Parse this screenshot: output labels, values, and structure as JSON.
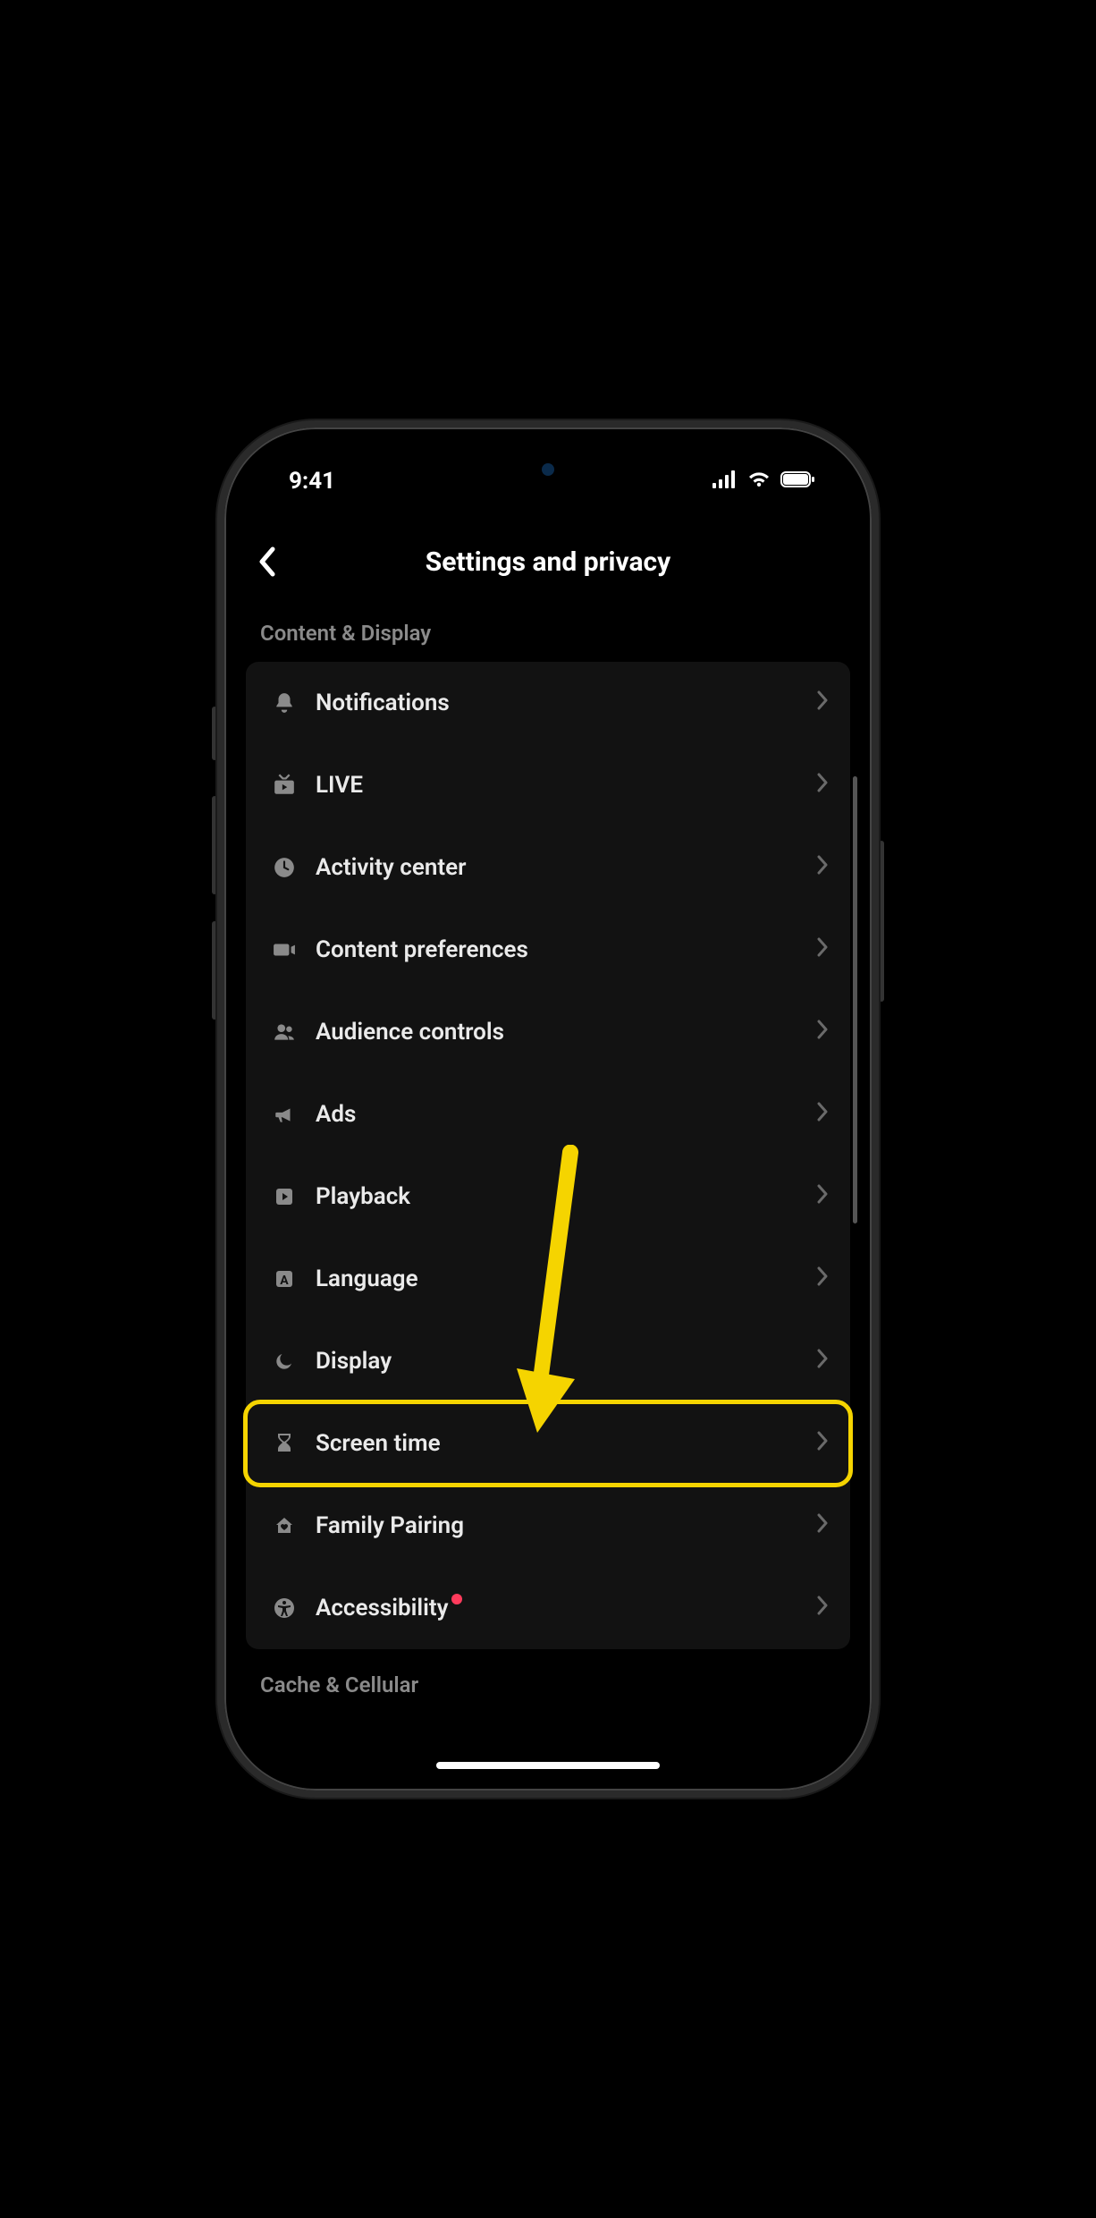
{
  "status": {
    "time": "9:41"
  },
  "header": {
    "title": "Settings and privacy"
  },
  "sections": [
    {
      "header": "Content & Display"
    },
    {
      "header": "Cache & Cellular"
    }
  ],
  "menu": {
    "items": [
      {
        "icon": "bell-icon",
        "label": "Notifications"
      },
      {
        "icon": "live-tv-icon",
        "label": "LIVE"
      },
      {
        "icon": "clock-icon",
        "label": "Activity center"
      },
      {
        "icon": "video-camera-icon",
        "label": "Content preferences"
      },
      {
        "icon": "people-icon",
        "label": "Audience controls"
      },
      {
        "icon": "megaphone-icon",
        "label": "Ads"
      },
      {
        "icon": "play-square-icon",
        "label": "Playback"
      },
      {
        "icon": "letter-a-icon",
        "label": "Language"
      },
      {
        "icon": "moon-icon",
        "label": "Display"
      },
      {
        "icon": "hourglass-icon",
        "label": "Screen time"
      },
      {
        "icon": "home-heart-icon",
        "label": "Family Pairing"
      },
      {
        "icon": "accessibility-icon",
        "label": "Accessibility",
        "badge": true
      }
    ]
  },
  "annotation": {
    "highlight_index": 9,
    "arrow_color": "#f5d400"
  }
}
